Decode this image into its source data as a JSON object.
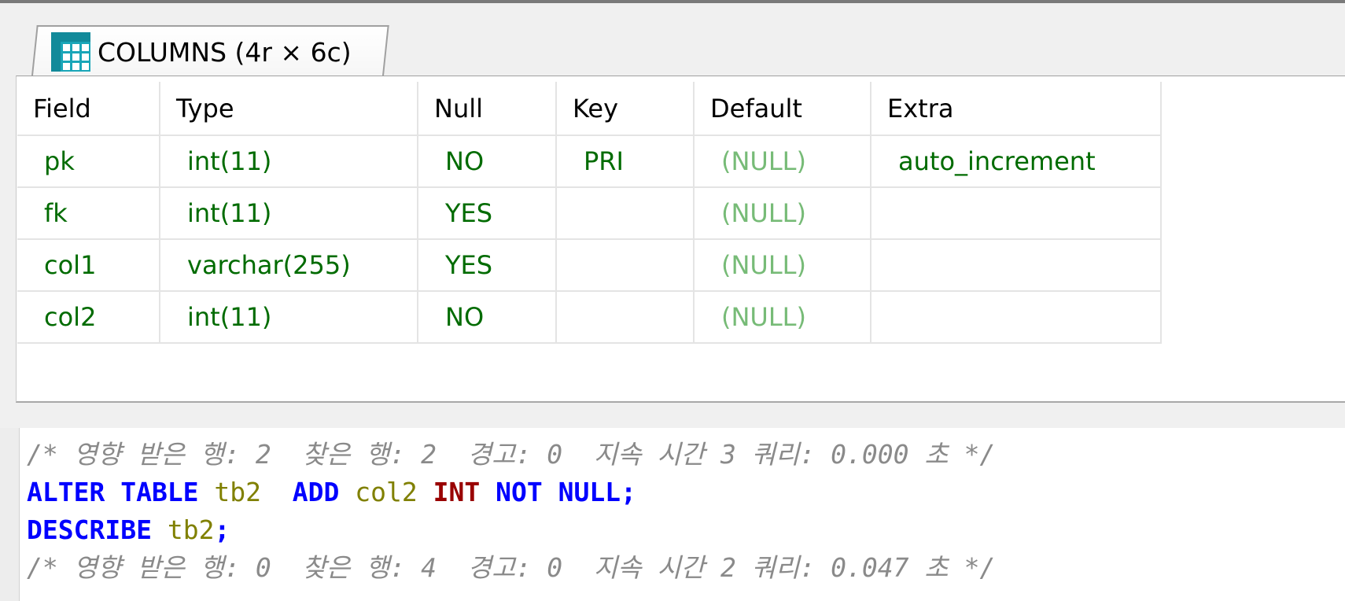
{
  "results": {
    "tab": {
      "label": "COLUMNS (4r × 6c)",
      "icon": "table-grid-icon"
    },
    "columns": [
      "Field",
      "Type",
      "Null",
      "Key",
      "Default",
      "Extra"
    ],
    "rows": [
      [
        "pk",
        "int(11)",
        "NO",
        "PRI",
        "(NULL)",
        "auto_increment"
      ],
      [
        "fk",
        "int(11)",
        "YES",
        "",
        "(NULL)",
        ""
      ],
      [
        "col1",
        "varchar(255)",
        "YES",
        "",
        "(NULL)",
        ""
      ],
      [
        "col2",
        "int(11)",
        "NO",
        "",
        "(NULL)",
        ""
      ]
    ]
  },
  "editor": {
    "line1": "/* 영향 받은 행: 2  찾은 행: 2  경고: 0  지속 시간 3 쿼리: 0.000 초 */",
    "line2": {
      "kw1": "ALTER TABLE",
      "table": "tb2",
      "kw2": "ADD",
      "column": "col2",
      "type": "INT",
      "kw3": "NOT NULL",
      "end": ";"
    },
    "line3": {
      "kw": "DESCRIBE",
      "table": "tb2",
      "end": ";"
    },
    "line4": "/* 영향 받은 행: 0  찾은 행: 4  경고: 0  지속 시간 2 쿼리: 0.047 초 */"
  },
  "colors": {
    "cell_text": "#006b00",
    "null_text": "#77bb77",
    "keyword": "#0000ff",
    "datatype": "#990000",
    "identifier": "#808000",
    "comment": "#8a8a8a"
  }
}
